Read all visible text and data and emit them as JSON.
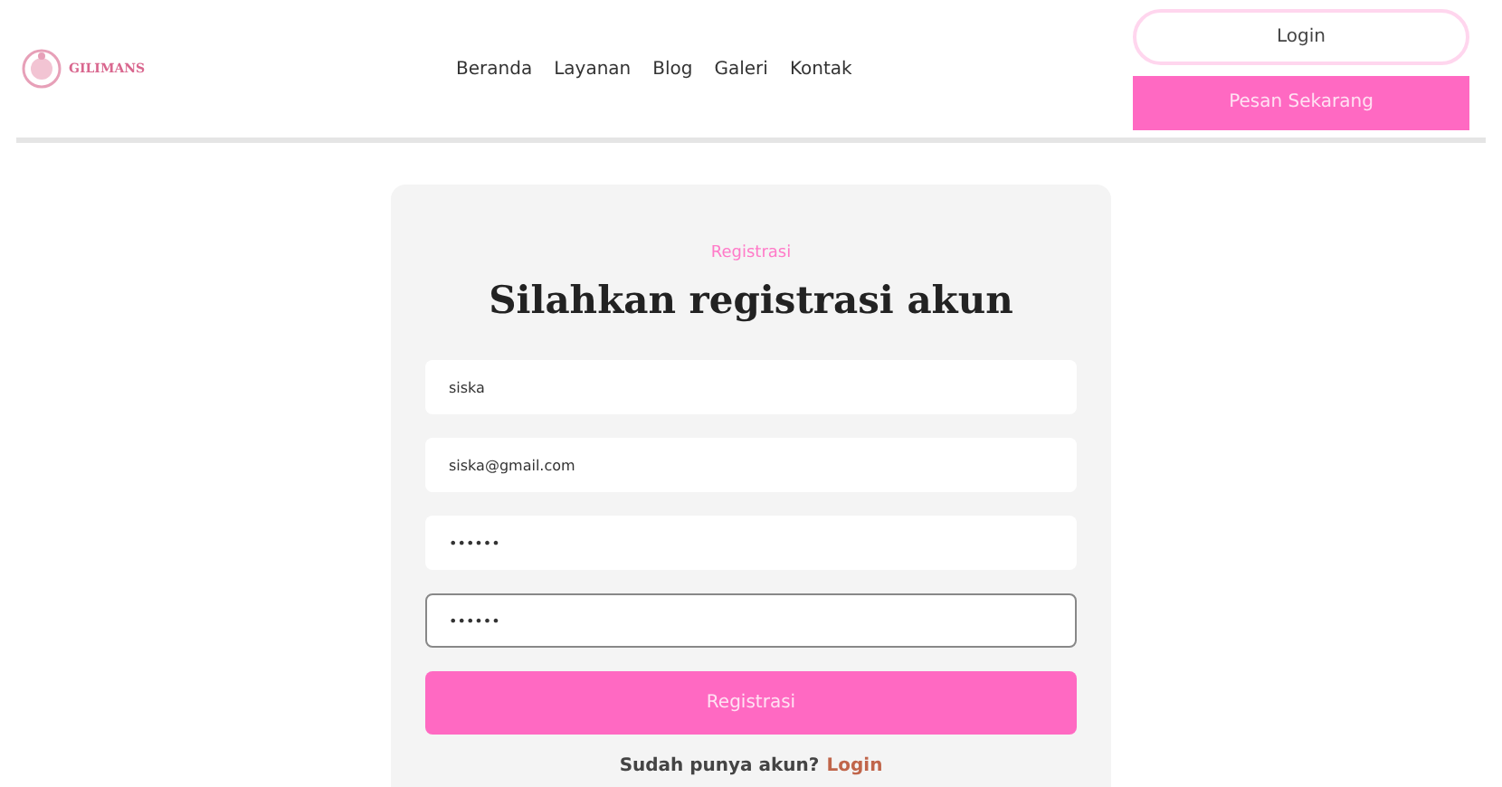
{
  "brand": "GILIMANS",
  "nav": [
    "Beranda",
    "Layanan",
    "Blog",
    "Galeri",
    "Kontak"
  ],
  "header_buttons": [
    {
      "label": "Login",
      "kind": "outline"
    },
    {
      "label": "Pesan Sekarang",
      "kind": "filled"
    }
  ],
  "form": {
    "eyebrow": "Registrasi",
    "title": "Silahkan registrasi akun",
    "fields": [
      {
        "value": "siska",
        "focused": false
      },
      {
        "value": "siska@gmail.com",
        "focused": false
      },
      {
        "value": "••••••",
        "focused": false
      },
      {
        "value": "••••••",
        "focused": true
      }
    ],
    "submit": "Registrasi",
    "footer_text": "Sudah punya akun?",
    "footer_link": "Login"
  }
}
